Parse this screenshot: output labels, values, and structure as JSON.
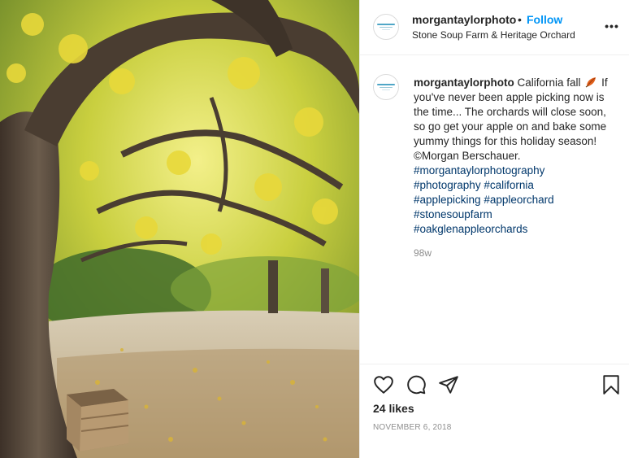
{
  "photo": {
    "icon": "orchard-photo"
  },
  "header": {
    "username": "morgantaylorphoto",
    "separator": "•",
    "follow_label": "Follow",
    "location": "Stone Soup Farm & Heritage Orchard",
    "more_icon": "more-horizontal-icon"
  },
  "caption": {
    "username": "morgantaylorphoto",
    "text": "California fall",
    "emoji_icon": "autumn-leaf-icon",
    "body": "If you've never been apple picking now is the time... The orchards will close soon, so go get your apple on and bake some yummy things for this holiday season! ©Morgan Berschauer.",
    "hashtags": [
      "#morgantaylorphotography",
      "#photography #california",
      "#applepicking #appleorchard",
      "#stonesoupfarm",
      "#oakglenappleorchards"
    ],
    "time_ago": "98w"
  },
  "actions": {
    "like_icon": "heart-icon",
    "comment_icon": "comment-icon",
    "share_icon": "paper-plane-icon",
    "save_icon": "bookmark-icon",
    "likes": "24 likes",
    "date": "NOVEMBER 6, 2018"
  },
  "colors": {
    "link_blue": "#0095f6",
    "hashtag_blue": "#00376b",
    "muted": "#8e8e8e",
    "border": "#efefef"
  }
}
